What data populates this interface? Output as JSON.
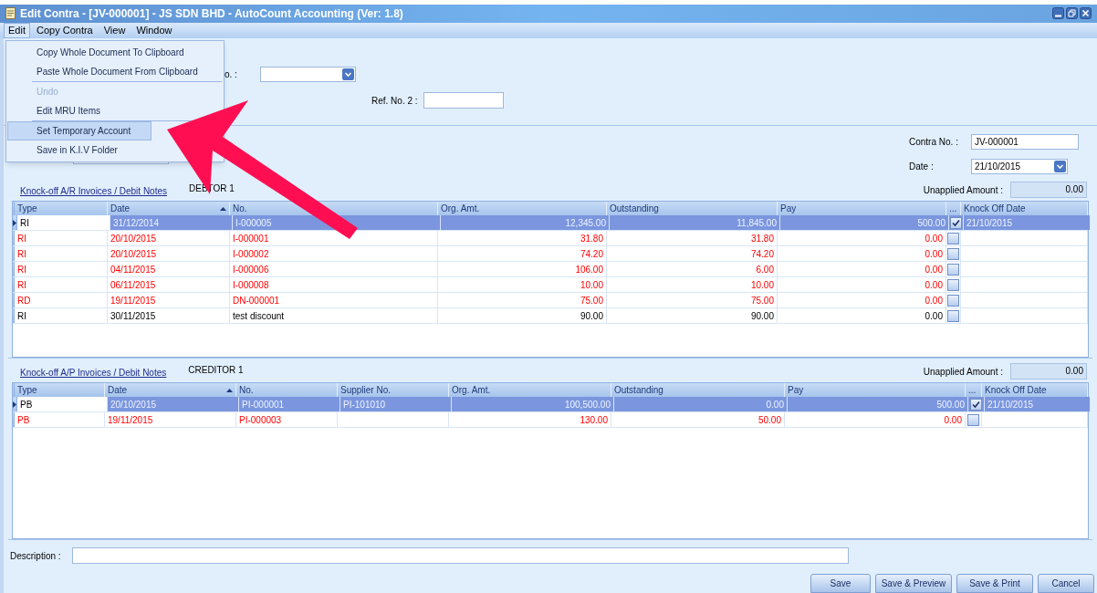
{
  "window": {
    "title": "Edit Contra - [JV-000001] - JS SDN BHD - AutoCount Accounting (Ver: 1.8)"
  },
  "menu_bar": [
    {
      "label": "Edit",
      "selected": true
    },
    {
      "label": "Copy Contra",
      "selected": false
    },
    {
      "label": "View",
      "selected": false
    },
    {
      "label": "Window",
      "selected": false
    }
  ],
  "edit_menu": [
    {
      "label": "Copy Whole Document To Clipboard",
      "disabled": false,
      "selected": false,
      "separator_after": false
    },
    {
      "label": "Paste Whole Document From Clipboard",
      "disabled": false,
      "selected": false,
      "separator_after": true
    },
    {
      "label": "Undo",
      "disabled": true,
      "selected": false,
      "separator_after": false
    },
    {
      "label": "Edit MRU Items",
      "disabled": false,
      "selected": false,
      "separator_after": true
    },
    {
      "label": "Set Temporary Account",
      "disabled": false,
      "selected": true,
      "separator_after": false
    },
    {
      "label": "Save in K.I.V Folder",
      "disabled": false,
      "selected": false,
      "separator_after": false
    }
  ],
  "header": {
    "partial_label": "o. :",
    "ref_no_2_label": "Ref. No. 2 :",
    "contra_no_label": "Contra No. :",
    "contra_no": "JV-000001",
    "date_label": "Date :",
    "date": "21/10/2015"
  },
  "ar_section": {
    "link": "Knock-off A/R Invoices / Debit Notes",
    "party": "DEBTOR 1",
    "unapplied_label": "Unapplied Amount :",
    "unapplied_amount": "0.00",
    "columns": [
      {
        "label": "Type",
        "sorted": false
      },
      {
        "label": "Date",
        "sorted": true
      },
      {
        "label": "No.",
        "sorted": false
      },
      {
        "label": "Org. Amt.",
        "sorted": false
      },
      {
        "label": "Outstanding",
        "sorted": false
      },
      {
        "label": "Pay",
        "sorted": false
      },
      {
        "label": "...",
        "sorted": false
      },
      {
        "label": "Knock Off Date",
        "sorted": false
      }
    ],
    "rows": [
      {
        "type": "RI",
        "date": "31/12/2014",
        "no": "I-000005",
        "org_amt": "12,345.00",
        "outstanding": "11,845.00",
        "pay": "500.00",
        "checked": true,
        "knock_off_date": "21/10/2015",
        "selected": true,
        "color": "#000000"
      },
      {
        "type": "RI",
        "date": "20/10/2015",
        "no": "I-000001",
        "org_amt": "31.80",
        "outstanding": "31.80",
        "pay": "0.00",
        "checked": false,
        "selected": false,
        "color": "#ff0000"
      },
      {
        "type": "RI",
        "date": "20/10/2015",
        "no": "I-000002",
        "org_amt": "74.20",
        "outstanding": "74.20",
        "pay": "0.00",
        "checked": false,
        "selected": false,
        "color": "#ff0000"
      },
      {
        "type": "RI",
        "date": "04/11/2015",
        "no": "I-000006",
        "org_amt": "106.00",
        "outstanding": "6.00",
        "pay": "0.00",
        "checked": false,
        "selected": false,
        "color": "#ff0000"
      },
      {
        "type": "RI",
        "date": "06/11/2015",
        "no": "I-000008",
        "org_amt": "10.00",
        "outstanding": "10.00",
        "pay": "0.00",
        "checked": false,
        "selected": false,
        "color": "#ff0000"
      },
      {
        "type": "RD",
        "date": "19/11/2015",
        "no": "DN-000001",
        "org_amt": "75.00",
        "outstanding": "75.00",
        "pay": "0.00",
        "checked": false,
        "selected": false,
        "color": "#ff0000"
      },
      {
        "type": "RI",
        "date": "30/11/2015",
        "no": "test discount",
        "org_amt": "90.00",
        "outstanding": "90.00",
        "pay": "0.00",
        "checked": false,
        "selected": false,
        "color": "#000000"
      }
    ]
  },
  "ap_section": {
    "link": "Knock-off A/P Invoices / Debit Notes",
    "party": "CREDITOR 1",
    "unapplied_label": "Unapplied Amount :",
    "unapplied_amount": "0.00",
    "columns": [
      {
        "label": "Type",
        "sorted": false
      },
      {
        "label": "Date",
        "sorted": true
      },
      {
        "label": "No.",
        "sorted": false
      },
      {
        "label": "Supplier No.",
        "sorted": false
      },
      {
        "label": "Org. Amt.",
        "sorted": false
      },
      {
        "label": "Outstanding",
        "sorted": false
      },
      {
        "label": "Pay",
        "sorted": false
      },
      {
        "label": "...",
        "sorted": false
      },
      {
        "label": "Knock Off Date",
        "sorted": false
      }
    ],
    "rows": [
      {
        "type": "PB",
        "date": "20/10/2015",
        "no": "PI-000001",
        "supplier_no": "PI-101010",
        "org_amt": "100,500.00",
        "outstanding": "0.00",
        "pay": "500.00",
        "checked": true,
        "knock_off_date": "21/10/2015",
        "selected": true,
        "color": "#000000"
      },
      {
        "type": "PB",
        "date": "19/11/2015",
        "no": "PI-000003",
        "org_amt": "130.00",
        "outstanding": "50.00",
        "pay": "0.00",
        "checked": false,
        "selected": false,
        "color": "#ff0000"
      }
    ]
  },
  "description": {
    "label": "Description :"
  },
  "buttons": [
    "Save",
    "Save & Preview",
    "Save & Print",
    "Cancel"
  ]
}
